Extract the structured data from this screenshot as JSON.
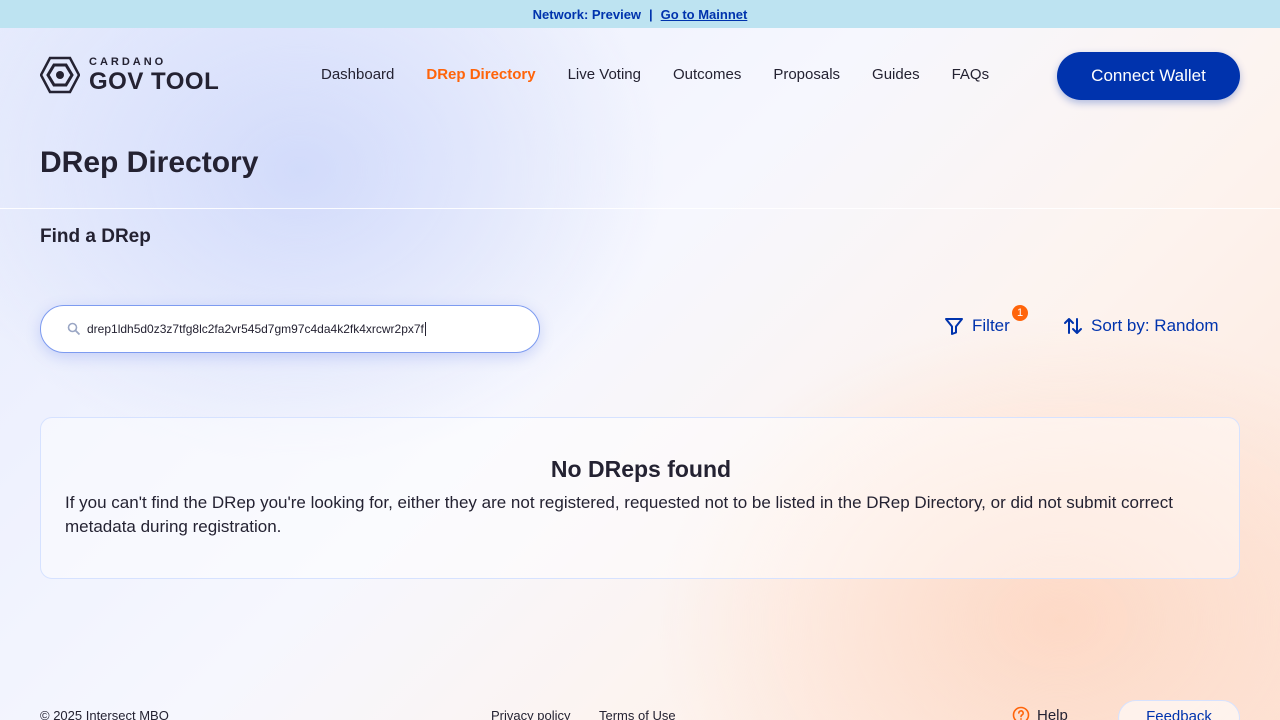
{
  "topbar": {
    "network_text": "Network: Preview",
    "separator": "|",
    "mainnet_link": "Go to Mainnet"
  },
  "logo": {
    "small": "CARDANO",
    "big": "GOV TOOL"
  },
  "nav": {
    "items": [
      "Dashboard",
      "DRep Directory",
      "Live Voting",
      "Outcomes",
      "Proposals",
      "Guides",
      "FAQs"
    ],
    "active": "DRep Directory"
  },
  "connect_wallet": "Connect Wallet",
  "page_title": "DRep Directory",
  "subtitle": "Find a DRep",
  "search": {
    "value": "drep1ldh5d0z3z7tfg8lc2fa2vr545d7gm97c4da4k2fk4xrcwr2px7f",
    "icon": "search-icon"
  },
  "filter": {
    "label": "Filter",
    "badge": "1",
    "icon": "filter-icon"
  },
  "sort": {
    "label": "Sort by: Random",
    "icon": "sort-arrows-icon"
  },
  "empty_state": {
    "title": "No DReps found",
    "text": "If you can't find the DRep you're looking for, either they are not registered, requested not to be listed in the DRep Directory, or did not submit correct metadata during registration."
  },
  "footer": {
    "copyright": "© 2025 Intersect MBO",
    "privacy": "Privacy policy",
    "terms": "Terms of Use",
    "help": "Help",
    "feedback": "Feedback"
  },
  "colors": {
    "primary": "#0033ad",
    "accent": "#ff640a",
    "topbar": "#bde3f1",
    "text": "#242232"
  }
}
